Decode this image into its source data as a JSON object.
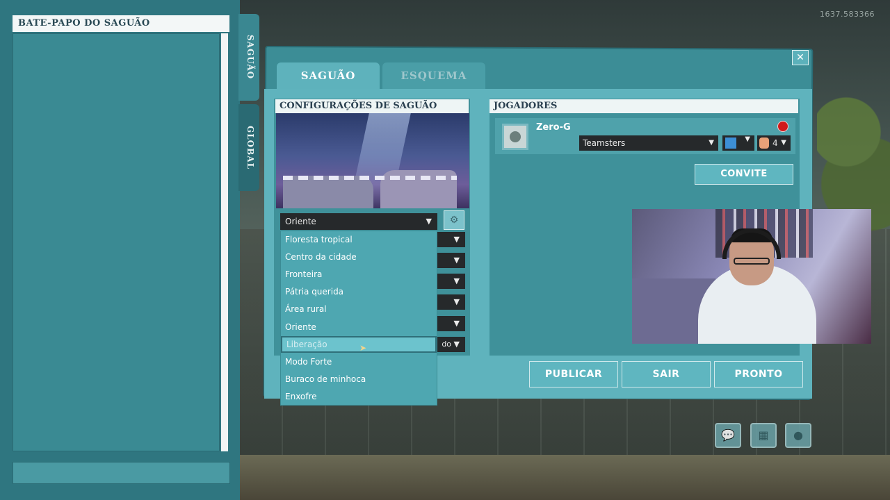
{
  "version": "1637.583366",
  "chat": {
    "title": "BATE-PAPO DO SAGUÃO"
  },
  "side_tabs": [
    "SAGUÃO",
    "GLOBAL"
  ],
  "tabs": [
    "SAGUÃO",
    "ESQUEMA"
  ],
  "config": {
    "title": "CONFIGURAÇÕES DE SAGUÃO",
    "selected_theme": "Oriente",
    "theme_options": [
      "Floresta tropical",
      "Centro da cidade",
      "Fronteira",
      "Pátria querida",
      "Área rural",
      "Oriente",
      "Liberação",
      "Modo Forte",
      "Buraco de minhoca",
      "Enxofre"
    ],
    "highlighted_option": "Liberação",
    "partial_setting_text": "do"
  },
  "players": {
    "title": "JOGADORES",
    "list": [
      {
        "name": "Zero-G",
        "team": "Teamsters",
        "worm_count": "4",
        "team_color": "#3d8fd6"
      }
    ],
    "invite_label": "CONVITE"
  },
  "buttons": {
    "publish": "PUBLICAR",
    "exit": "SAIR",
    "ready": "PRONTO"
  },
  "colors": {
    "panel": "#2f7680",
    "accent": "#5fb6c0",
    "ready_indicator": "#d11a1a"
  }
}
